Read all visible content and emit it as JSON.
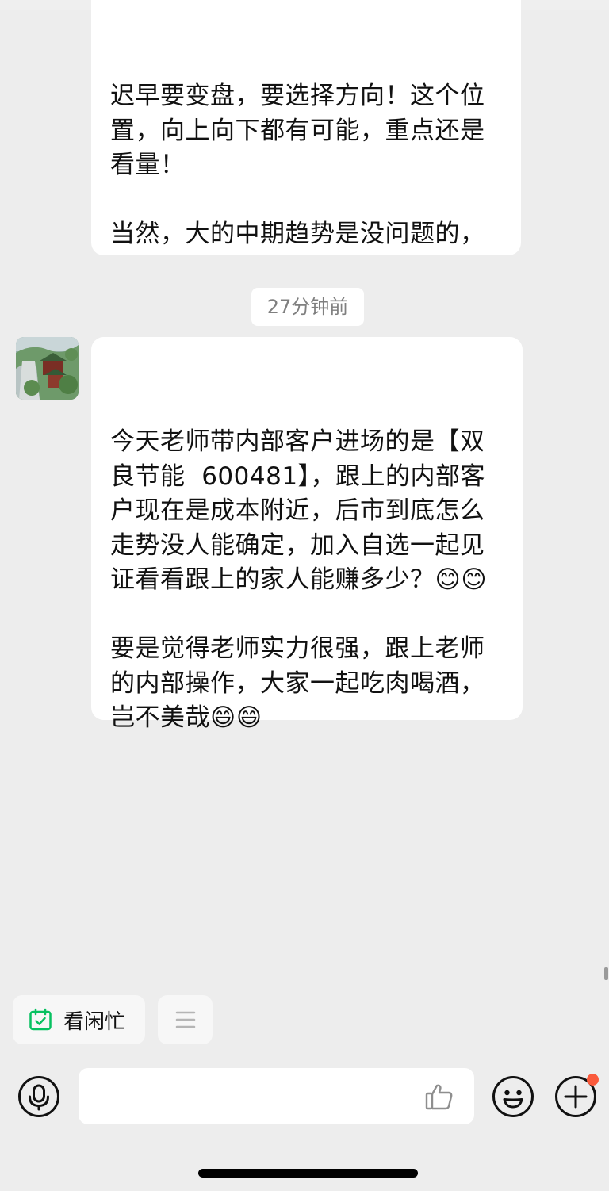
{
  "chat": {
    "messages": [
      {
        "text": "迟早要变盘，要选择方向！这个位置，向上向下都有可能，重点还是看量！\n\n当然，大的中期趋势是没问题的，一旦回调，还是大家逢低参与的机会，注意把握节奏即可！"
      },
      {
        "timestamp": "27分钟前"
      },
      {
        "avatar": "landscape-avatar",
        "text": "今天老师带内部客户进场的是【双良节能  600481】，跟上的内部客户现在是成本附近，后市到底怎么走势没人能确定，加入自选一起见证看看跟上的家人能赚多少？😊😊\n\n要是觉得老师实力很强，跟上老师的内部操作，大家一起吃肉喝酒，岂不美哉😄😄"
      }
    ]
  },
  "quick_actions": {
    "schedule_label": "看闲忙",
    "schedule_icon": "calendar-check-icon",
    "menu_icon": "menu-lines-icon"
  },
  "input_bar": {
    "voice_icon": "voice-icon",
    "input_value": "",
    "like_icon": "thumbs-up-icon",
    "emoji_icon": "emoji-icon",
    "plus_icon": "plus-icon",
    "has_notification": true
  },
  "colors": {
    "background": "#EDEDED",
    "bubble": "#FFFFFF",
    "accent_green": "#07C160",
    "notification": "#FA5A3C"
  }
}
